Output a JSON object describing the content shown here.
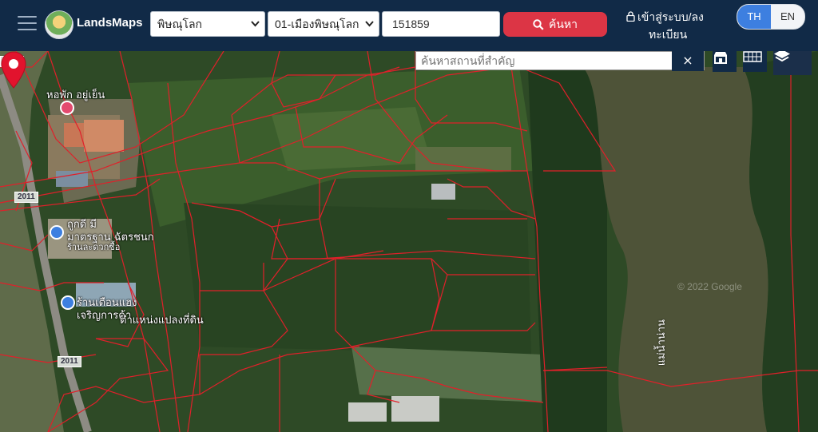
{
  "header": {
    "brand": "LandsMaps",
    "province_select": "พิษณุโลก",
    "district_select": "01-เมืองพิษณุโลก",
    "parcel_input": "151859",
    "search_button": "ค้นหา",
    "login_line1": "เข้าสู่ระบบ/ลง",
    "login_line2": "ทะเบียน",
    "lang_th": "TH",
    "lang_en": "EN"
  },
  "map": {
    "search_placeholder": "ค้นหาสถานที่สำคัญ",
    "clear_icon": "×",
    "labels": {
      "hostel": "หอพัก อยู่เย็น",
      "shop1_line1": "ถูกดี มี",
      "shop1_line2": "มาตรฐาน ฉัตรชนก",
      "shop1_line3": "ร้านละดวกซื้อ",
      "shop2_line1": "ร้านเตือนแฮง",
      "shop2_line2": "เจริญการค้า",
      "parcel_location": "ตำแหน่งแปลงที่ดิน",
      "river": "แม่น้ำน่าน",
      "watermark": "© 2022 Google"
    },
    "road_shields": [
      "2011",
      "2011",
      "2011"
    ],
    "icons": {
      "menu": "hamburger-menu-icon",
      "search": "search-icon",
      "lock": "lock-icon",
      "store": "store-icon",
      "grid": "grid-icon",
      "layers": "layers-icon",
      "pin": "map-pin-icon"
    },
    "colors": {
      "header_bg": "#112a47",
      "search_btn": "#dc3545",
      "lang_active": "#3d7fe0",
      "parcel_lines": "#e0202a"
    }
  }
}
